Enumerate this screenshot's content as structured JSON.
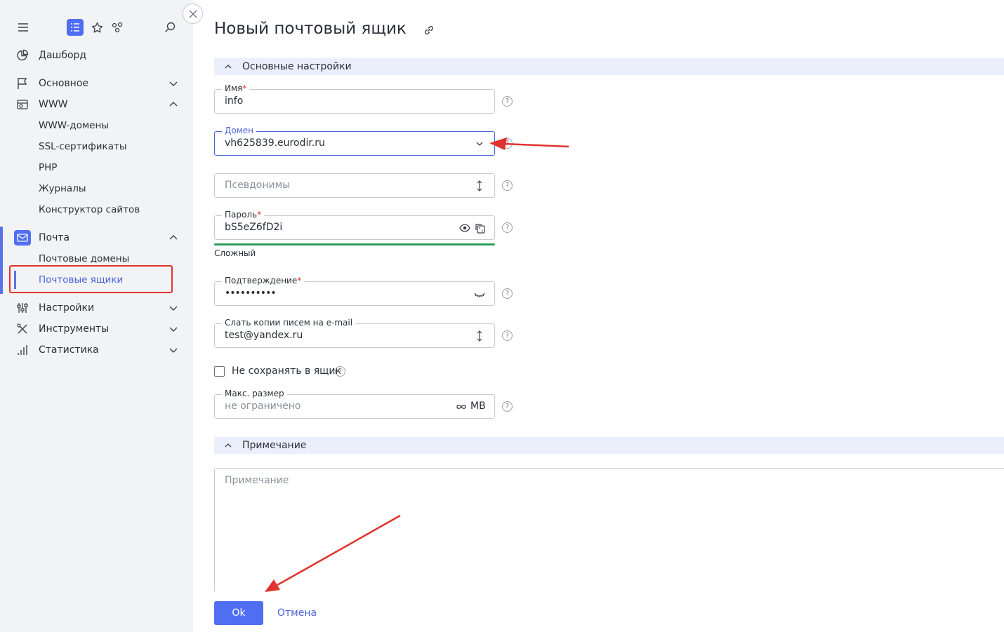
{
  "sidebar": {
    "top_icons": [
      "menu-icon",
      "list-icon",
      "star-icon",
      "share-icon",
      "search-icon"
    ],
    "items": [
      {
        "label": "Дашборд"
      },
      {
        "label": "Основное"
      },
      {
        "label": "WWW"
      },
      {
        "label": "WWW-домены"
      },
      {
        "label": "SSL-сертификаты"
      },
      {
        "label": "PHP"
      },
      {
        "label": "Журналы"
      },
      {
        "label": "Конструктор сайтов"
      },
      {
        "label": "Почта"
      },
      {
        "label": "Почтовые домены"
      },
      {
        "label": "Почтовые ящики"
      },
      {
        "label": "Настройки"
      },
      {
        "label": "Инструменты"
      },
      {
        "label": "Статистика"
      }
    ]
  },
  "main": {
    "title": "Новый почтовый ящик",
    "section_main": "Основные настройки",
    "fields": {
      "name": {
        "label": "Имя",
        "value": "info",
        "required": "*"
      },
      "domain": {
        "label": "Домен",
        "value": "vh625839.eurodir.ru"
      },
      "aliases": {
        "placeholder": "Псевдонимы"
      },
      "password": {
        "label": "Пароль",
        "value": "bS5eZ6fD2i",
        "required": "*",
        "strength": "Сложный"
      },
      "confirm": {
        "label": "Подтверждение",
        "value": "••••••••••",
        "required": "*"
      },
      "copies": {
        "label": "Слать копии писем на e-mail",
        "value": "test@yandex.ru"
      },
      "no_save": {
        "label": "Не сохранять в ящик"
      },
      "max_size": {
        "label": "Макс. размер",
        "placeholder": "не ограничено",
        "unit": "MB"
      }
    },
    "help_glyph": "?",
    "section_note": "Примечание",
    "note_placeholder": "Примечание",
    "ok_label": "Ok",
    "cancel_label": "Отмена"
  },
  "colors": {
    "accent": "#4f6ef2",
    "annotation": "#e0332e",
    "strength": "#2e9e5b"
  }
}
